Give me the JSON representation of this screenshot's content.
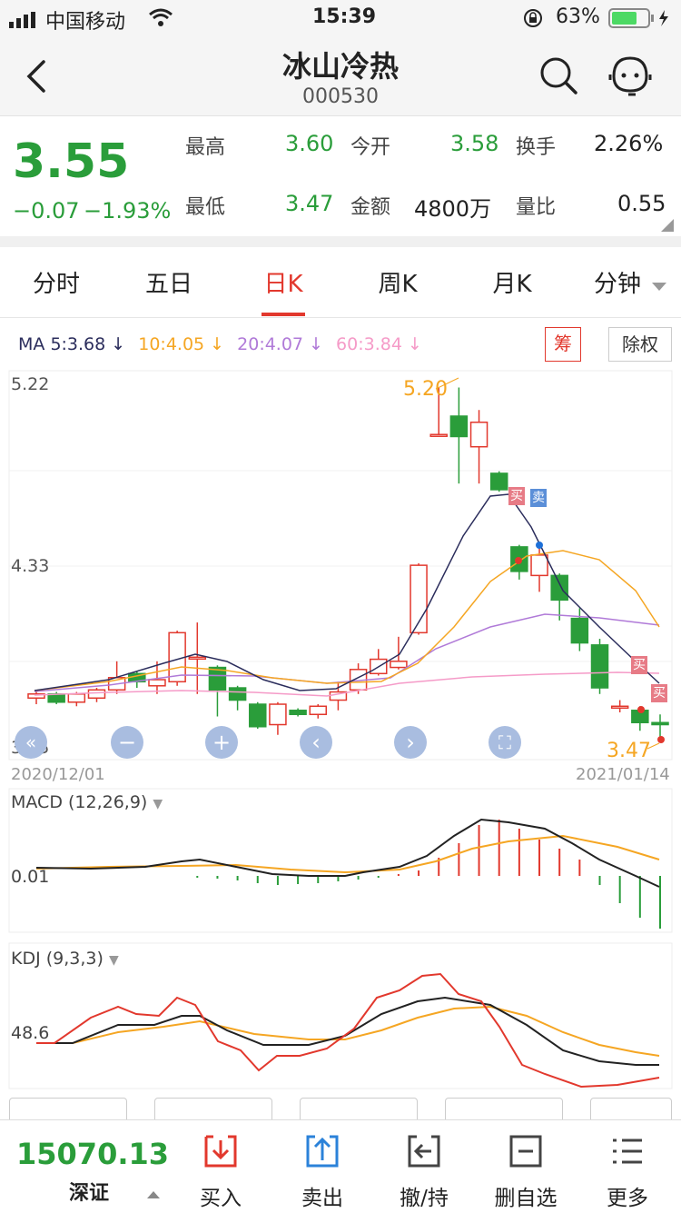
{
  "status": {
    "carrier": "中国移动",
    "time": "15:39",
    "battery": "63%"
  },
  "header": {
    "name": "冰山冷热",
    "code": "000530"
  },
  "quote": {
    "price": "3.55",
    "change": "−0.07",
    "change_pct": "−1.93%",
    "high_label": "最高",
    "high": "3.60",
    "low_label": "最低",
    "low": "3.47",
    "open_label": "今开",
    "open": "3.58",
    "amount_label": "金额",
    "amount": "4800万",
    "turnover_label": "换手",
    "turnover": "2.26%",
    "volratio_label": "量比",
    "volratio": "0.55"
  },
  "tabs": [
    "分时",
    "五日",
    "日K",
    "周K",
    "月K",
    "分钟"
  ],
  "ma": {
    "prefix": "MA",
    "ma5": "5:3.68 ↓",
    "ma10": "10:4.05 ↓",
    "ma20": "20:4.07 ↓",
    "ma60": "60:3.84 ↓",
    "chip_button": "筹",
    "exright_button": "除权"
  },
  "colors": {
    "up": "#e2382d",
    "down": "#2a9d3a",
    "ma5": "#2b2d5c",
    "ma10": "#f5a623",
    "ma20": "#b07ad8",
    "ma60": "#f59bc8"
  },
  "kchart": {
    "y_top_label": "5.22",
    "y_mid_label": "4.33",
    "y_bottom_label": "3.45",
    "date_start": "2020/12/01",
    "date_end": "2021/01/14",
    "max_label": "5.20",
    "min_label": "3.47",
    "buy_tag": "买",
    "sell_tag": "卖"
  },
  "macd": {
    "title": "MACD (12,26,9)",
    "zero_label": "0.01"
  },
  "kdj": {
    "title": "KDJ (9,3,3)",
    "mid_label": "48.6"
  },
  "bottom": {
    "index_value": "15070.13",
    "index_name": "深证",
    "buttons": [
      "买入",
      "卖出",
      "撤/持",
      "删自选",
      "更多"
    ]
  },
  "chart_data": {
    "type": "candlestick",
    "ylim": [
      3.45,
      5.22
    ],
    "candles": [
      {
        "o": 3.68,
        "c": 3.7,
        "h": 3.71,
        "l": 3.65
      },
      {
        "o": 3.7,
        "c": 3.66,
        "h": 3.71,
        "l": 3.65
      },
      {
        "o": 3.66,
        "c": 3.7,
        "h": 3.71,
        "l": 3.64
      },
      {
        "o": 3.68,
        "c": 3.72,
        "h": 3.73,
        "l": 3.66
      },
      {
        "o": 3.72,
        "c": 3.78,
        "h": 3.86,
        "l": 3.7
      },
      {
        "o": 3.8,
        "c": 3.76,
        "h": 3.81,
        "l": 3.73
      },
      {
        "o": 3.74,
        "c": 3.77,
        "h": 3.86,
        "l": 3.7
      },
      {
        "o": 3.76,
        "c": 4.0,
        "h": 4.01,
        "l": 3.74
      },
      {
        "o": 3.88,
        "c": 3.88,
        "h": 4.05,
        "l": 3.7
      },
      {
        "o": 3.83,
        "c": 3.72,
        "h": 3.84,
        "l": 3.59
      },
      {
        "o": 3.73,
        "c": 3.67,
        "h": 3.74,
        "l": 3.62
      },
      {
        "o": 3.65,
        "c": 3.54,
        "h": 3.66,
        "l": 3.53
      },
      {
        "o": 3.55,
        "c": 3.65,
        "h": 3.66,
        "l": 3.5
      },
      {
        "o": 3.62,
        "c": 3.6,
        "h": 3.63,
        "l": 3.59
      },
      {
        "o": 3.6,
        "c": 3.64,
        "h": 3.65,
        "l": 3.58
      },
      {
        "o": 3.67,
        "c": 3.71,
        "h": 3.76,
        "l": 3.62
      },
      {
        "o": 3.72,
        "c": 3.82,
        "h": 3.85,
        "l": 3.7
      },
      {
        "o": 3.8,
        "c": 3.87,
        "h": 3.92,
        "l": 3.79
      },
      {
        "o": 3.83,
        "c": 3.86,
        "h": 3.98,
        "l": 3.82
      },
      {
        "o": 4.0,
        "c": 4.33,
        "h": 4.34,
        "l": 3.99
      },
      {
        "o": 4.97,
        "c": 4.97,
        "h": 5.2,
        "l": 4.97
      },
      {
        "o": 5.06,
        "c": 4.96,
        "h": 5.2,
        "l": 4.73
      },
      {
        "o": 4.91,
        "c": 5.03,
        "h": 5.09,
        "l": 4.73
      },
      {
        "o": 4.78,
        "c": 4.7,
        "h": 4.79,
        "l": 4.69
      },
      {
        "o": 4.42,
        "c": 4.3,
        "h": 4.43,
        "l": 4.26
      },
      {
        "o": 4.28,
        "c": 4.38,
        "h": 4.43,
        "l": 4.2
      },
      {
        "o": 4.28,
        "c": 4.16,
        "h": 4.29,
        "l": 4.06
      },
      {
        "o": 4.07,
        "c": 3.95,
        "h": 4.12,
        "l": 3.91
      },
      {
        "o": 3.94,
        "c": 3.73,
        "h": 3.97,
        "l": 3.7
      },
      {
        "o": 3.64,
        "c": 3.64,
        "h": 3.67,
        "l": 3.61
      },
      {
        "o": 3.62,
        "c": 3.56,
        "h": 3.64,
        "l": 3.52
      },
      {
        "o": 3.56,
        "c": 3.55,
        "h": 3.6,
        "l": 3.47
      }
    ]
  }
}
